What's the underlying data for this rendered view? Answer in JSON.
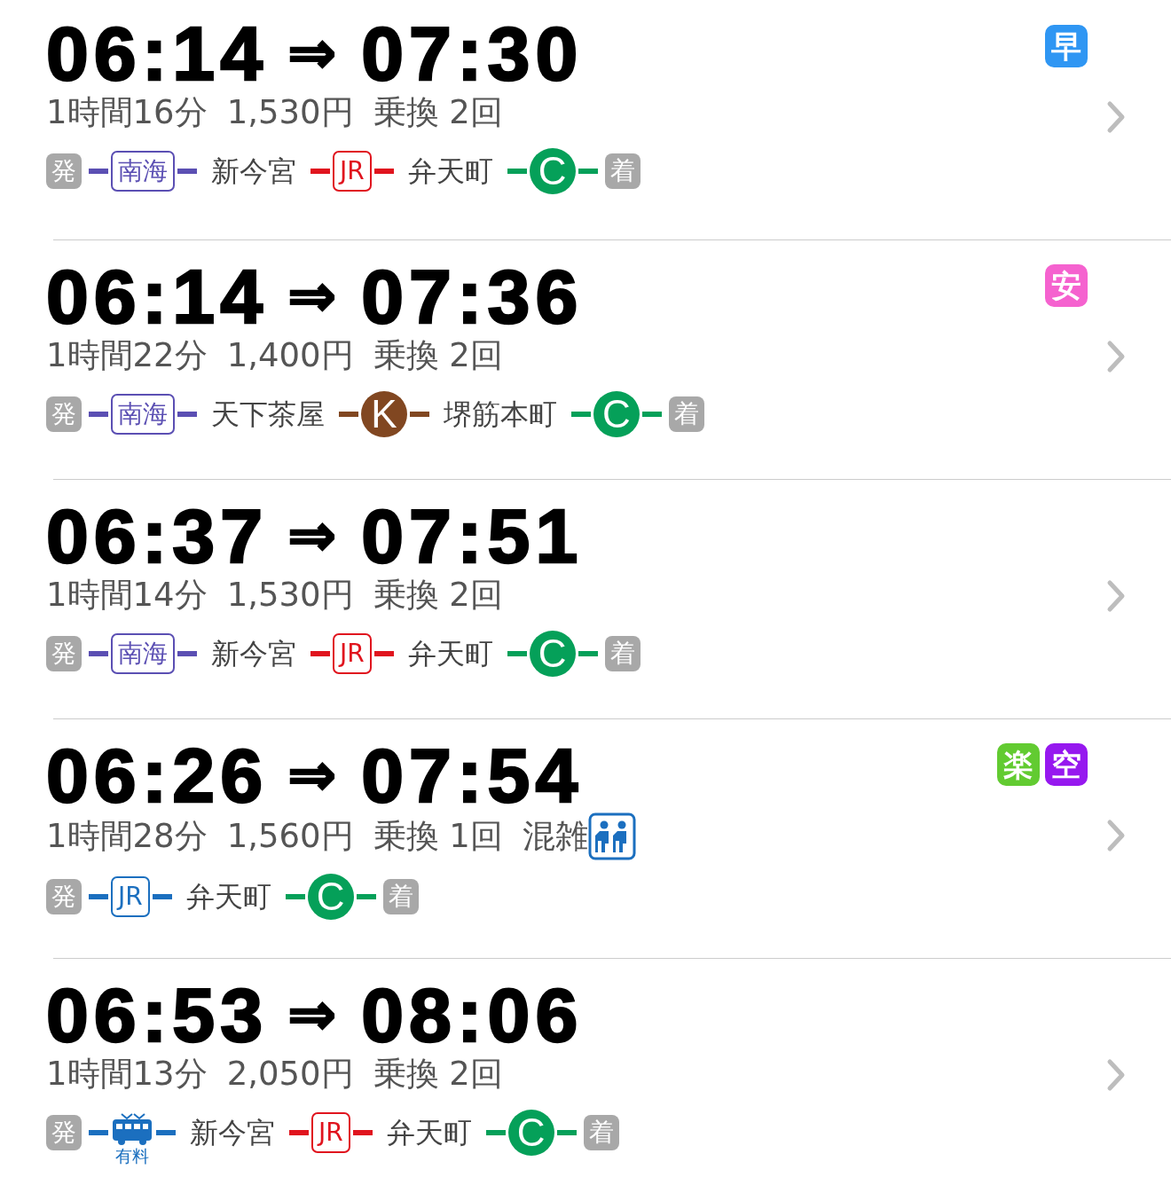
{
  "routes": [
    {
      "depart": "06:14",
      "arrow": "⇒",
      "arrive": "07:30",
      "duration": "1時間16分",
      "fare": "1,530円",
      "transfers": "乗換 2回",
      "badges": [
        {
          "text": "早",
          "color": "#2f96f3"
        }
      ],
      "segments": [
        {
          "kind": "origin",
          "text": "発"
        },
        {
          "kind": "railbox",
          "text": "南海",
          "color": "#5b4fb3"
        },
        {
          "kind": "station",
          "text": "新今宮"
        },
        {
          "kind": "railbox",
          "text": "JR",
          "color": "#e0141e"
        },
        {
          "kind": "station",
          "text": "弁天町"
        },
        {
          "kind": "subway",
          "text": "C",
          "color": "#05a059"
        },
        {
          "kind": "dest",
          "text": "着"
        }
      ]
    },
    {
      "depart": "06:14",
      "arrow": "⇒",
      "arrive": "07:36",
      "duration": "1時間22分",
      "fare": "1,400円",
      "transfers": "乗換 2回",
      "badges": [
        {
          "text": "安",
          "color": "#f562cf"
        }
      ],
      "segments": [
        {
          "kind": "origin",
          "text": "発"
        },
        {
          "kind": "railbox",
          "text": "南海",
          "color": "#5b4fb3"
        },
        {
          "kind": "station",
          "text": "天下茶屋"
        },
        {
          "kind": "subway",
          "text": "K",
          "color": "#814721"
        },
        {
          "kind": "station",
          "text": "堺筋本町"
        },
        {
          "kind": "subway",
          "text": "C",
          "color": "#05a059"
        },
        {
          "kind": "dest",
          "text": "着"
        }
      ]
    },
    {
      "depart": "06:37",
      "arrow": "⇒",
      "arrive": "07:51",
      "duration": "1時間14分",
      "fare": "1,530円",
      "transfers": "乗換 2回",
      "segments": [
        {
          "kind": "origin",
          "text": "発"
        },
        {
          "kind": "railbox",
          "text": "南海",
          "color": "#5b4fb3"
        },
        {
          "kind": "station",
          "text": "新今宮"
        },
        {
          "kind": "railbox",
          "text": "JR",
          "color": "#e0141e"
        },
        {
          "kind": "station",
          "text": "弁天町"
        },
        {
          "kind": "subway",
          "text": "C",
          "color": "#05a059"
        },
        {
          "kind": "dest",
          "text": "着"
        }
      ]
    },
    {
      "depart": "06:26",
      "arrow": "⇒",
      "arrive": "07:54",
      "duration": "1時間28分",
      "fare": "1,560円",
      "transfers": "乗換 1回",
      "congestion": "混雑",
      "badges": [
        {
          "text": "楽",
          "color": "#62cb31"
        },
        {
          "text": "空",
          "color": "#9618ef"
        }
      ],
      "segments": [
        {
          "kind": "origin",
          "text": "発"
        },
        {
          "kind": "railbox",
          "text": "JR",
          "color": "#1b6fbf"
        },
        {
          "kind": "station",
          "text": "弁天町"
        },
        {
          "kind": "subway",
          "text": "C",
          "color": "#05a059"
        },
        {
          "kind": "dest",
          "text": "着"
        }
      ]
    },
    {
      "depart": "06:53",
      "arrow": "⇒",
      "arrive": "08:06",
      "duration": "1時間13分",
      "fare": "2,050円",
      "transfers": "乗換 2回",
      "segments": [
        {
          "kind": "origin",
          "text": "発"
        },
        {
          "kind": "bus",
          "text": "有料",
          "color": "#1b6fbf"
        },
        {
          "kind": "station",
          "text": "新今宮"
        },
        {
          "kind": "railbox",
          "text": "JR",
          "color": "#e0141e"
        },
        {
          "kind": "station",
          "text": "弁天町"
        },
        {
          "kind": "subway",
          "text": "C",
          "color": "#05a059"
        },
        {
          "kind": "dest",
          "text": "着"
        }
      ]
    }
  ]
}
